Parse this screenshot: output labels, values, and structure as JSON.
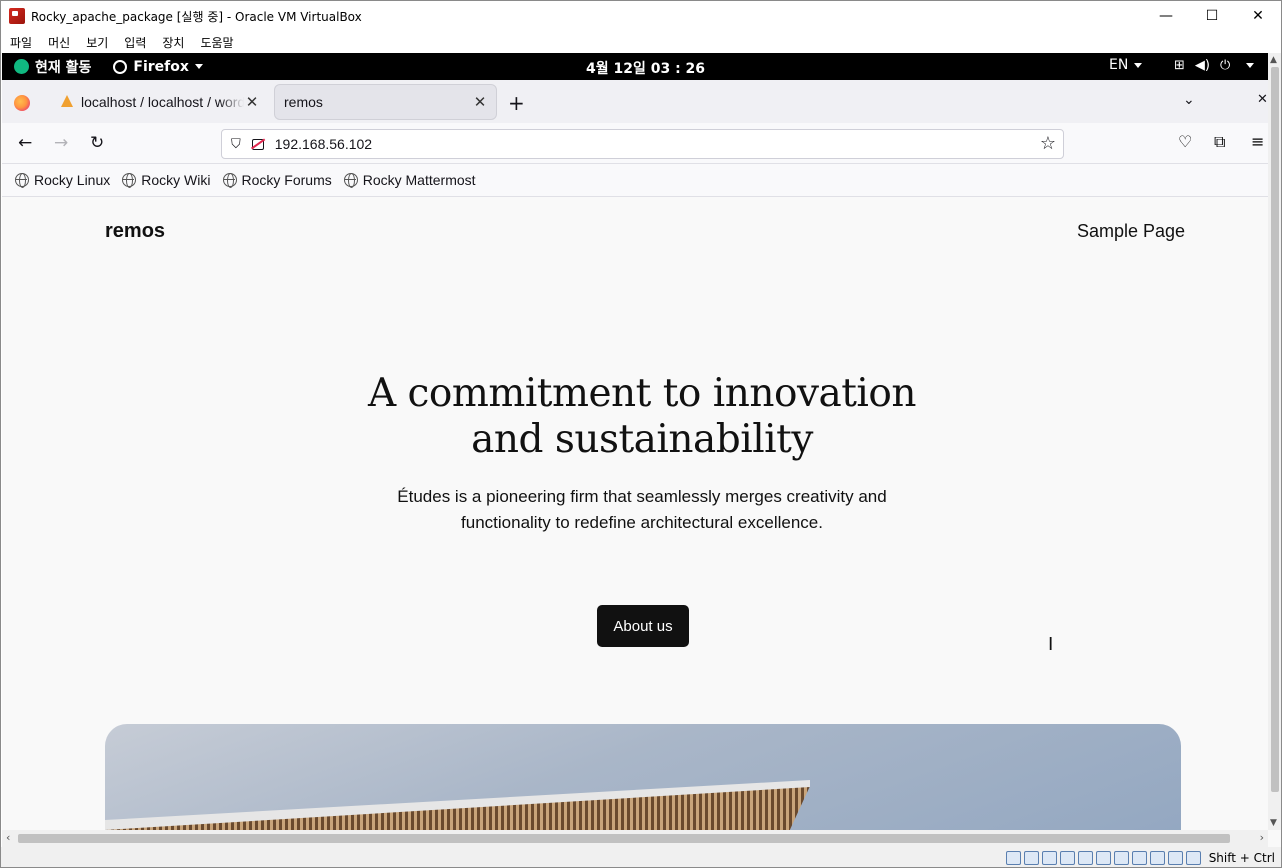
{
  "vbox": {
    "title": "Rocky_apache_package [실행 중] - Oracle VM VirtualBox",
    "menu": [
      "파일",
      "머신",
      "보기",
      "입력",
      "장치",
      "도움말"
    ],
    "host_key": "Shift + Ctrl"
  },
  "gnome": {
    "activities": "현재 활동",
    "app": "Firefox",
    "clock": "4월 12일  03 : 26",
    "lang": "EN"
  },
  "tabs": [
    {
      "title": "localhost / localhost / wordpress"
    },
    {
      "title": "remos"
    }
  ],
  "url": "192.168.56.102",
  "bookmarks": [
    "Rocky Linux",
    "Rocky Wiki",
    "Rocky Forums",
    "Rocky Mattermost"
  ],
  "site": {
    "title": "remos",
    "nav_link": "Sample Page",
    "hero_title_line1": "A commitment to innovation",
    "hero_title_line2": "and sustainability",
    "hero_sub_line1": "Études is a pioneering firm that seamlessly merges creativity and",
    "hero_sub_line2": "functionality to redefine architectural excellence.",
    "button": "About us"
  }
}
